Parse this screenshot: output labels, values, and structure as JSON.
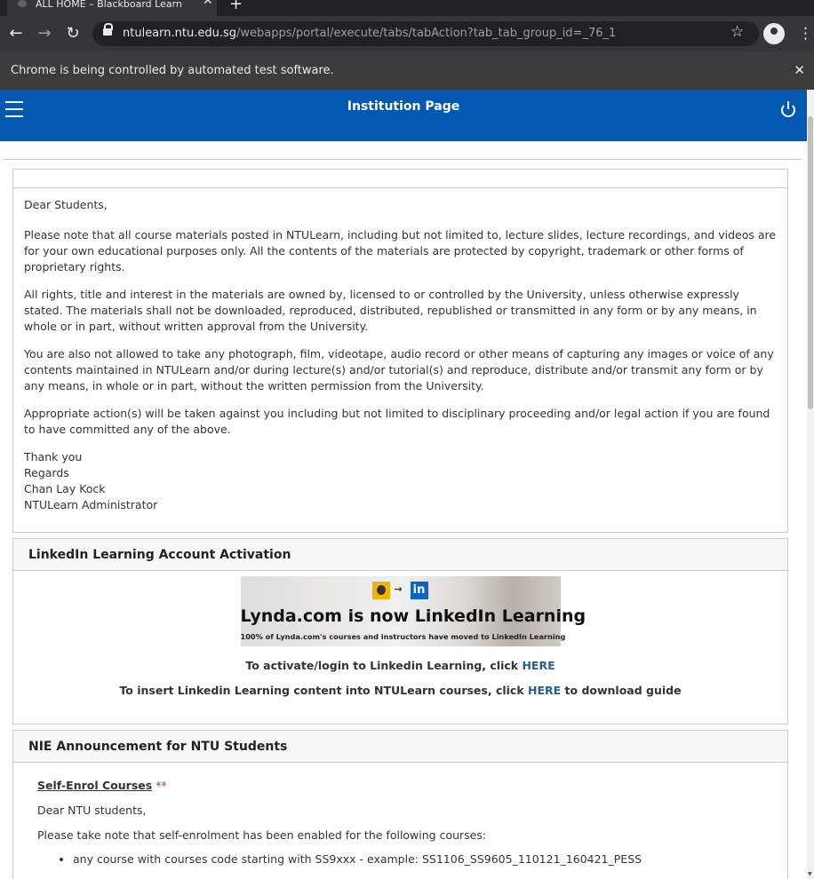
{
  "browser": {
    "tab_title": "ALL HOME – Blackboard Learn",
    "url_host": "ntulearn.ntu.edu.sg",
    "url_path": "/webapps/portal/execute/tabs/tabAction?tab_tab_group_id=_76_1",
    "infobar_text": "Chrome is being controlled by automated test software."
  },
  "header": {
    "title": "Institution Page"
  },
  "notice": {
    "greeting": "Dear Students,",
    "para1": "Please note that all course materials posted in NTULearn, including but not limited to, lecture slides, lecture recordings, and videos are for your own educational purposes only. All the contents of the materials are protected by copyright, trademark or other forms of proprietary rights.",
    "para2": "All rights, title and interest in the materials are owned by, licensed to or controlled by the University, unless otherwise expressly stated. The materials shall not be downloaded, reproduced, distributed, republished or transmitted in any form or by any means, in whole or in part, without written approval from the University.",
    "para3": "You are also not allowed to take any photograph, film, videotape, audio record or other means of capturing any images or voice of any contents maintained in NTULearn and/or during lecture(s) and/or tutorial(s) and reproduce, distribute and/or transmit any form or by any means, in whole or in part, without the written permission from the University.",
    "para4": "Appropriate action(s) will be taken against you including but not limited to disciplinary proceeding and/or legal action if you are found to have committed any of the above.",
    "sig_thanks": "Thank you",
    "sig_regards": "Regards",
    "sig_name": "Chan Lay Kock",
    "sig_role": "NTULearn Administrator"
  },
  "linkedin": {
    "heading": "LinkedIn Learning Account Activation",
    "banner_title": "Lynda.com is now LinkedIn Learning",
    "banner_sub": "100% of Lynda.com's courses and instructors have moved to LinkedIn Learning",
    "banner_li": "in",
    "line1_text": "To activate/login to Linkedin Learning, click ",
    "line1_link": "HERE",
    "line2_text": "To insert Linkedin Learning content into NTULearn courses, click ",
    "line2_link": "HERE",
    "line2_suffix": " to download guide"
  },
  "nie": {
    "heading": "NIE Announcement for NTU Students",
    "selfenrol": "Self-Enrol Courses",
    "selfenrol_stars": " **",
    "greeting": "Dear NTU students,",
    "intro": "Please take note that self-enrolment has been enabled for the following courses:",
    "bullet1": "any course with courses code starting with SS9xxx - example: SS1106_SS9605_110121_160421_PESS"
  }
}
